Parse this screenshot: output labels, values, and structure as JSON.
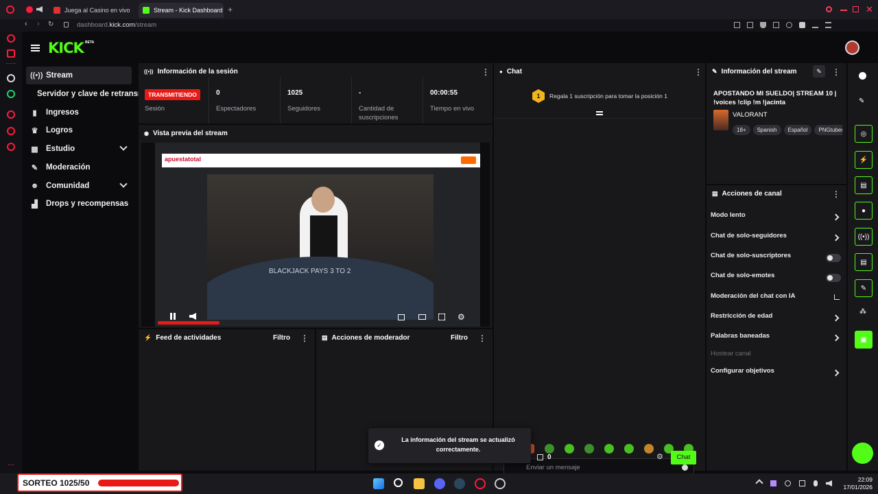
{
  "browser": {
    "tabs": [
      {
        "label": "Juega al Casino en vivo"
      },
      {
        "label": "Stream - Kick Dashboard"
      }
    ],
    "url_host": "dashboard.",
    "url_domain": "kick.com",
    "url_path": "/stream"
  },
  "header": {
    "logo": "KICK",
    "logo_badge": "BETA"
  },
  "sidebar": {
    "items": [
      {
        "label": "Stream",
        "icon": "broadcast-icon"
      },
      {
        "label": "Servidor y clave de retransmisión"
      },
      {
        "label": "Ingresos",
        "icon": "chart-icon"
      },
      {
        "label": "Logros",
        "icon": "trophy-icon"
      },
      {
        "label": "Estudio",
        "icon": "grid-icon"
      },
      {
        "label": "Moderación",
        "icon": "wrench-icon"
      },
      {
        "label": "Comunidad",
        "icon": "people-icon"
      },
      {
        "label": "Drops y recompensas",
        "icon": "drops-icon"
      }
    ]
  },
  "session": {
    "title": "Información de la sesión",
    "status_badge": "TRANSMITIENDO",
    "status_label": "Sesión",
    "stats": [
      {
        "value": "0",
        "label": "Espectadores"
      },
      {
        "value": "1025",
        "label": "Seguidores"
      },
      {
        "value": "-",
        "label": "Cantidad de suscripciones"
      },
      {
        "value": "00:00:55",
        "label": "Tiempo en vivo"
      }
    ]
  },
  "preview": {
    "title": "Vista previa del stream",
    "inner_brand": "apuestatotal",
    "inner_text": "BLACKJACK PAYS 3 TO 2"
  },
  "activity": {
    "title": "Feed de actividades",
    "filter": "Filtro"
  },
  "modactions": {
    "title": "Acciones de moderador",
    "filter": "Filtro"
  },
  "chat": {
    "title": "Chat",
    "gift_rank": "1",
    "gift_text": "Regala 1 suscripción para tomar la posición 1",
    "input_placeholder": "Enviar un mensaje",
    "points": "0",
    "send": "Chat"
  },
  "stream_info": {
    "title": "Información del stream",
    "stream_title": "APOSTANDO MI SUELDO| STREAM 10 | !voices !clip !m !jacinta",
    "category": "VALORANT",
    "tags": [
      "18+",
      "Spanish",
      "Español",
      "PNGtuber"
    ]
  },
  "channel_actions": {
    "title": "Acciones de canal",
    "rows": [
      {
        "label": "Modo lento",
        "control": "arrow"
      },
      {
        "label": "Chat de solo-seguidores",
        "control": "arrow"
      },
      {
        "label": "Chat de solo-suscriptores",
        "control": "toggle",
        "on": false
      },
      {
        "label": "Chat de solo-emotes",
        "control": "toggle",
        "on": false
      },
      {
        "label": "Moderación del chat con IA",
        "control": "external"
      },
      {
        "label": "Restricción de edad",
        "control": "arrow"
      },
      {
        "label": "Palabras baneadas",
        "control": "arrow"
      },
      {
        "label": "Hostear canal",
        "control": "none",
        "disabled": true
      },
      {
        "label": "Configurar objetivos",
        "control": "arrow"
      }
    ]
  },
  "toast": {
    "text": "La información del stream se actualizó correctamente."
  },
  "overlay": {
    "raffle": "SORTEO 1025/50"
  },
  "taskbar": {
    "time": "22:09",
    "date": "17/01/2026"
  },
  "colors": {
    "accent": "#53fc18",
    "live": "#e91916",
    "panel": "#18181b",
    "bg": "#0b0b0d"
  }
}
